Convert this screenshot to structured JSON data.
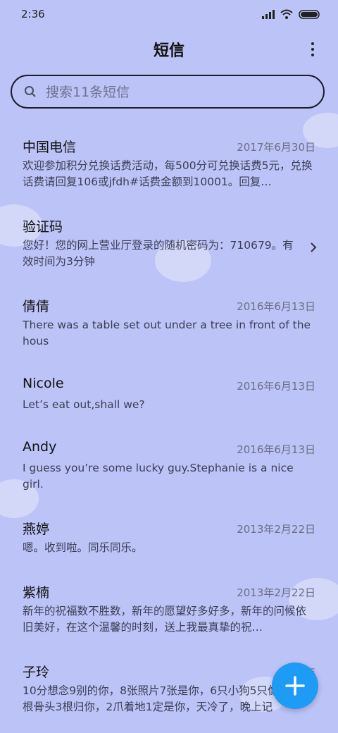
{
  "status": {
    "time": "2:36",
    "icons": [
      "signal-icon",
      "wifi-icon",
      "battery-icon"
    ]
  },
  "header": {
    "title": "短信",
    "menu_icon": "more-vertical-icon"
  },
  "search": {
    "placeholder": "搜索11条短信",
    "value": ""
  },
  "messages": [
    {
      "name": "中国电信",
      "date": "2017年6月30日",
      "preview": "欢迎参加积分兑换话费活动，每500分可兑换话费5元，兑换话费请回复106或jfdh#话费金额到10001。回复…"
    },
    {
      "name": "验证码",
      "date": "",
      "preview": "您好！您的网上营业厅登录的随机密码为：710679。有效时间为3分钟"
    },
    {
      "name": "倩倩",
      "date": "2016年6月13日",
      "preview": "There was a table set out under a tree in front of the hous"
    },
    {
      "name": "Nicole",
      "date": "2016年6月13日",
      "preview": "Let’s eat out,shall we?"
    },
    {
      "name": "Andy",
      "date": "2016年6月13日",
      "preview": "I guess you’re some lucky guy.Stephanie is a nice girl."
    },
    {
      "name": "燕婷",
      "date": "2013年2月22日",
      "preview": "嗯。收到啦。同乐同乐。"
    },
    {
      "name": "紫楠",
      "date": "2013年2月22日",
      "preview": "新年的祝福数不胜数，新年的愿望好多好多，新年的问候依旧美好，在这个温馨的时刻，送上我最真挚的祝…"
    },
    {
      "name": "子玲",
      "date": "2013年",
      "preview": "10分想念9别的你，8张照片7张是你，6只小狗5只像你，4根骨头3根归你，2爪着地1定是你，天冷了，晚上记"
    }
  ],
  "fab": {
    "icon": "plus-icon"
  },
  "colors": {
    "background": "#bcc3f6",
    "fab": "#1e9bf5"
  }
}
